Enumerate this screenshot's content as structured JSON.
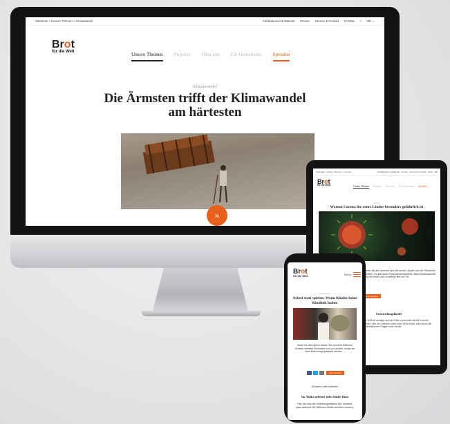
{
  "desktop": {
    "breadcrumb": "Startseite > Unsere Themen > Klimawandel",
    "utility_links": [
      "Publikationen & Material",
      "Presse",
      "Service & Kontakt",
      "Shop",
      "DE"
    ],
    "logo": {
      "word1": "Br",
      "word_o": "o",
      "word2": "t",
      "sub": "für die Welt"
    },
    "nav": [
      "Unsere Themen",
      "Projekte",
      "Über uns",
      "Für Gemeinden",
      "Spenden"
    ],
    "kicker": "Klimawandel",
    "headline_line1": "Die Ärmsten trifft der Klimawandel",
    "headline_line2": "am härtesten",
    "scroll_icon": "»"
  },
  "tablet": {
    "topbar_left": "Startseite > Unsere Themen > Corona",
    "topbar_right": "Publikationen & Material · Presse · Service & Kontakt · Shop · DE",
    "logo": {
      "word1": "Br",
      "word_o": "o",
      "word2": "t",
      "sub": "für die Welt"
    },
    "nav": [
      "Unsere Themen",
      "Projekte",
      "Über uns",
      "Für Gemeinden",
      "Spenden"
    ],
    "kicker": "Corona",
    "headline": "Warum Corona für arme Länder besonders gefährlich ist",
    "body": "Stärker als alle anderen sind die armen Länder von der Pandemie betroffen. Es gibt kaum Gesundheitssysteme, kaum Medikamente, aber viel Armut und zu wenig Hilfe vor Ort.",
    "section": "Entwicklungsländer",
    "body2": "Die Welt ist weniger auf die Krise vorbereitet als die reichen Länder. Wer am meisten unter dem Virus leidet, wird durch die wirtschaftlichen Folgen noch ärmer.",
    "button": "Jetzt spenden"
  },
  "phone": {
    "logo": {
      "word1": "Br",
      "word_o": "o",
      "word2": "t",
      "sub": "für die Welt"
    },
    "menu_label": "Menü",
    "kicker": "Kinderarbeit",
    "headline": "Arbeit statt spielen: Wenn Kinder keine Kindheit haben",
    "body": "Arbeit ist nicht gleich Arbeit. Sie verwehrt Millionen Kindern weltweit Kindheiten und zu schulen, wohin sie ohne Betreuung gelassen werden ...",
    "section_label": "Schlafen oder Arbeiten",
    "subhead": "Im Afrika arbeitet jedes fünfte Kind",
    "body2": "Hier hat man die Arbeitsorganisation IAO ermittelt, dass weltweit 152 Millionen Kinder arbeiten müssen.",
    "donate_button": "Jetzt spenden"
  }
}
